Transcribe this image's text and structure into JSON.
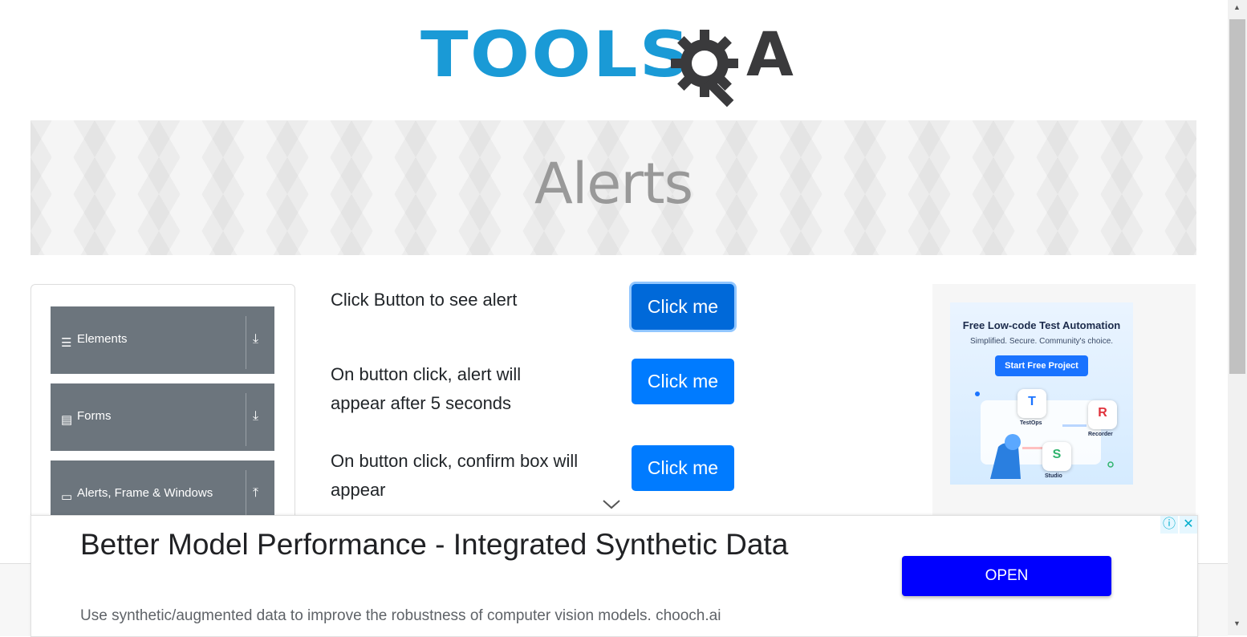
{
  "logo": {
    "text_tools": "TOOLS",
    "text_a": "A",
    "color_tools": "#1a9ad6",
    "color_qa": "#3a3a3c"
  },
  "banner": {
    "title": "Alerts"
  },
  "sidebar": {
    "items": [
      {
        "label": "Elements",
        "icon": "hamburger-icon",
        "arrow": "download-arrow-icon"
      },
      {
        "label": "Forms",
        "icon": "list-icon",
        "arrow": "download-arrow-icon"
      },
      {
        "label": "Alerts, Frame & Windows",
        "icon": "window-icon",
        "arrow": "upload-arrow-icon"
      }
    ]
  },
  "main": {
    "rows": [
      {
        "text": "Click Button to see alert",
        "button": "Click me"
      },
      {
        "text": "On button click, alert will appear after 5 seconds",
        "button": "Click me"
      },
      {
        "text": "On button click, confirm box will appear",
        "button": "Click me"
      }
    ]
  },
  "side_ad": {
    "title": "Free Low-code Test Automation",
    "subtitle": "Simplified. Secure. Community's choice.",
    "cta": "Start Free Project",
    "products": [
      {
        "letter": "T",
        "name": "TestOps"
      },
      {
        "letter": "R",
        "name": "Recorder"
      },
      {
        "letter": "S",
        "name": "Studio"
      }
    ]
  },
  "bottom_ad": {
    "headline": "Better Model Performance - Integrated Synthetic Data",
    "description": "Use synthetic/augmented data to improve the robustness of computer vision models. chooch.ai",
    "open_label": "OPEN",
    "info_glyph": "ⓘ",
    "close_glyph": "✕"
  },
  "colors": {
    "primary_button": "#007bff",
    "sidebar_item": "#6c757d",
    "ad_open": "#0000ff"
  }
}
